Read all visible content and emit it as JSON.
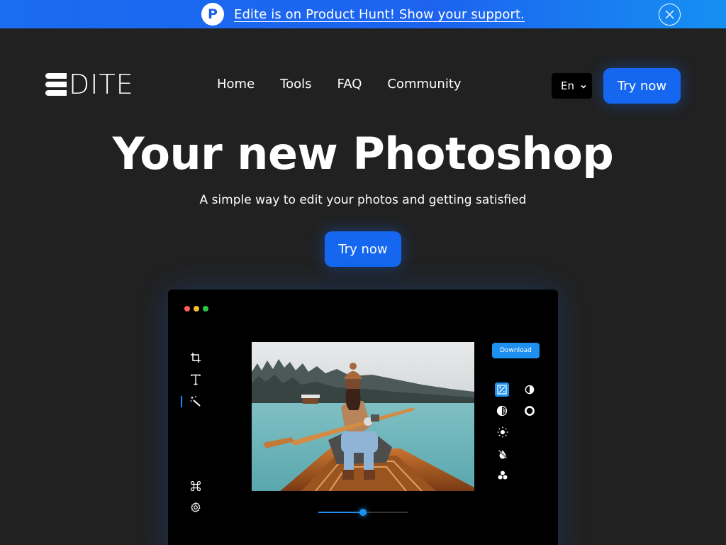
{
  "banner": {
    "badge_letter": "P",
    "text": "Edite is on Product Hunt! Show your support.",
    "close_icon": "close-icon"
  },
  "header": {
    "logo_text": "DITE",
    "nav": [
      {
        "label": "Home"
      },
      {
        "label": "Tools"
      },
      {
        "label": "FAQ"
      },
      {
        "label": "Community"
      }
    ],
    "language": "En",
    "cta_label": "Try now"
  },
  "hero": {
    "title": "Your new Photoshop",
    "subtitle": "A simple way to edit your photos and getting satisfied",
    "cta_label": "Try now"
  },
  "editor": {
    "window_dots": [
      "#ff5f57",
      "#febc2e",
      "#28c840"
    ],
    "tools": [
      "crop-icon",
      "text-icon",
      "magic-wand-icon",
      "command-icon",
      "settings-icon"
    ],
    "download_label": "Download",
    "adjustments": [
      "image-adjust-icon",
      "contrast-icon",
      "exposure-icon",
      "ring-icon",
      "brightness-icon",
      "hue-icon",
      "color-channels-icon"
    ],
    "slider_value": 0.5
  },
  "colors": {
    "background": "#212121",
    "accent": "#1467ee",
    "editor_accent": "#1e90f0"
  }
}
